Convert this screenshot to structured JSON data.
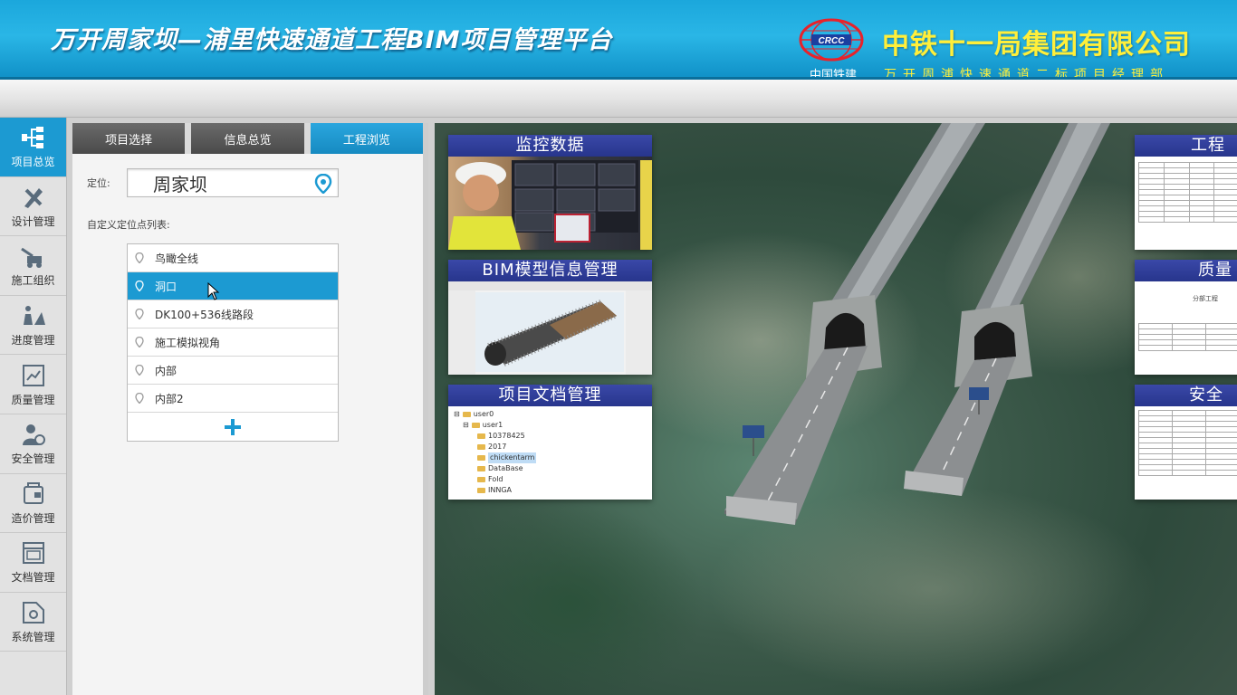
{
  "header": {
    "title": "万开周家坝—浦里快速通道工程BIM项目管理平台",
    "logo_label": "中国铁建",
    "company": "中铁十一局集团有限公司",
    "subcompany": "万开周浦快速通道二标项目经理部"
  },
  "colors": {
    "accent": "#1c9ad2",
    "header": "#22aee2",
    "company": "#ffef3a",
    "card_title": "#2f3d9c"
  },
  "sidebar": {
    "items": [
      {
        "label": "项目总览",
        "icon": "overview-icon",
        "active": true
      },
      {
        "label": "设计管理",
        "icon": "design-icon"
      },
      {
        "label": "施工组织",
        "icon": "construction-icon"
      },
      {
        "label": "进度管理",
        "icon": "progress-icon"
      },
      {
        "label": "质量管理",
        "icon": "quality-icon"
      },
      {
        "label": "安全管理",
        "icon": "safety-icon"
      },
      {
        "label": "造价管理",
        "icon": "cost-icon"
      },
      {
        "label": "文档管理",
        "icon": "document-icon"
      },
      {
        "label": "系统管理",
        "icon": "system-icon"
      }
    ]
  },
  "panel": {
    "tabs": [
      {
        "label": "项目选择"
      },
      {
        "label": "信息总览"
      },
      {
        "label": "工程浏览",
        "active": true
      }
    ],
    "location_label": "定位:",
    "location_value": "周家坝",
    "list_title": "自定义定位点列表:",
    "locations": [
      "鸟瞰全线",
      "洞口",
      "DK100+536线路段",
      "施工模拟视角",
      "内部",
      "内部2"
    ],
    "selected_index": 1
  },
  "cards": {
    "monitor": {
      "title": "监控数据"
    },
    "bim": {
      "title": "BIM模型信息管理"
    },
    "docs": {
      "title": "项目文档管理",
      "tree": [
        "user0",
        "user1",
        "10378425",
        "2017",
        "chickentarm",
        "DataBase",
        "Fold",
        "INNGA"
      ]
    },
    "project": {
      "title": "工程"
    },
    "quality": {
      "title": "质量",
      "text": "分部工程"
    },
    "safety": {
      "title": "安全"
    }
  }
}
